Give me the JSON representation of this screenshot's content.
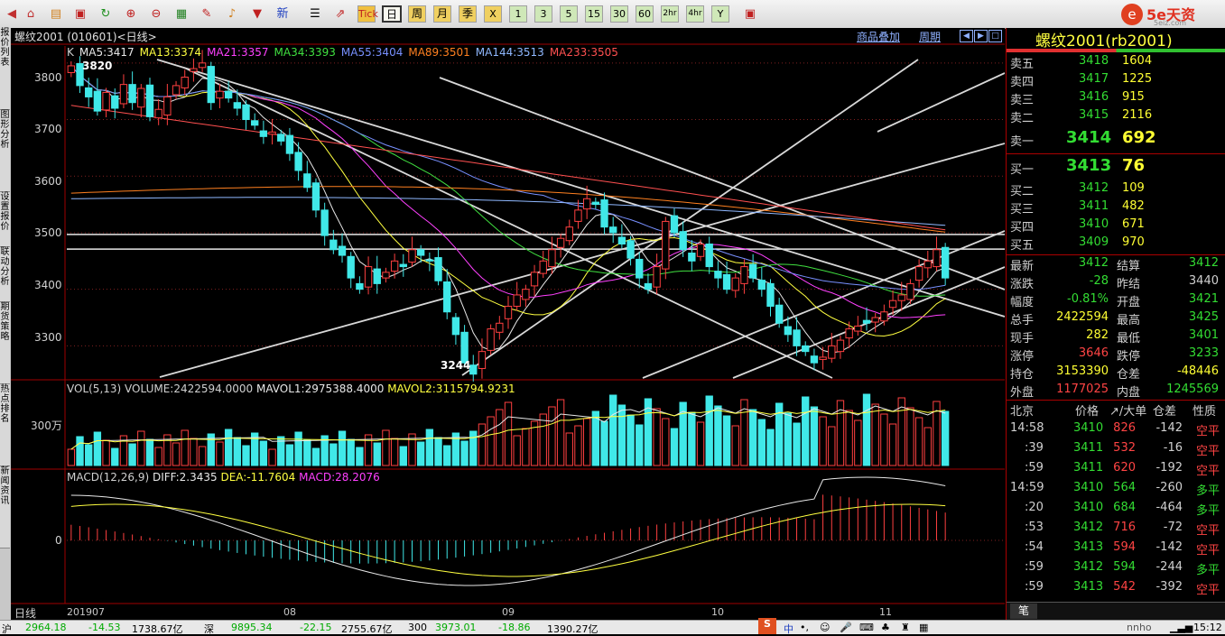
{
  "toolbar": {
    "buttons": [
      "Tick",
      "日",
      "周",
      "月",
      "季",
      "X",
      "1",
      "3",
      "5",
      "15",
      "30",
      "60",
      "2hr",
      "4hr",
      "Y"
    ],
    "xin": "新"
  },
  "leftrail": {
    "tabs": [
      "报价列表",
      "图形分析",
      "设置报价",
      "联动分析",
      "期货策略",
      "热点排名",
      "新闻资讯"
    ]
  },
  "chart": {
    "title": "螺纹2001 (010601)<日线>",
    "overlay_link": "商品叠加",
    "period_link": "周期",
    "ma_legend": [
      {
        "text": "K",
        "color": "#d0d0d0"
      },
      {
        "text": "MA5:3417",
        "color": "#e8e8e8"
      },
      {
        "text": "MA13:3374",
        "color": "#ffff40"
      },
      {
        "text": "MA21:3357",
        "color": "#ff40ff"
      },
      {
        "text": "MA34:3393",
        "color": "#40e040"
      },
      {
        "text": "MA55:3404",
        "color": "#7890ff"
      },
      {
        "text": "MA89:3501",
        "color": "#ff8020"
      },
      {
        "text": "MA144:3513",
        "color": "#8fb8ff"
      },
      {
        "text": "MA233:3505",
        "color": "#ff5050"
      }
    ],
    "price_axis": [
      "3800",
      "3700",
      "3600",
      "3500",
      "3400",
      "3300"
    ],
    "high_label": "3820",
    "low_label": "3244",
    "vol_legend": {
      "name": "VOL(5,13)",
      "volume": "VOLUME:2422594.0000",
      "mavol1": "MAVOL1:2975388.4000",
      "mavol2": "MAVOL2:3115794.9231"
    },
    "vol_axis": "300万",
    "macd_legend": {
      "name": "MACD(12,26,9)",
      "diff": "DIFF:2.3435",
      "dea": "DEA:-11.7604",
      "macd": "MACD:28.2076"
    },
    "macd_axis": "0",
    "x_axis": [
      "201907",
      "08",
      "09",
      "10",
      "11"
    ],
    "period_label": "日线"
  },
  "chart_data": {
    "type": "candlestick",
    "title": "螺纹2001 (010601)<日线>",
    "x_labels": [
      "201907",
      "08",
      "09",
      "10",
      "11"
    ],
    "y_range": [
      3240,
      3830
    ],
    "closes": [
      3795,
      3760,
      3740,
      3715,
      3748,
      3720,
      3762,
      3730,
      3755,
      3705,
      3718,
      3740,
      3760,
      3775,
      3790,
      3800,
      3730,
      3750,
      3738,
      3720,
      3700,
      3690,
      3670,
      3678,
      3662,
      3640,
      3610,
      3580,
      3540,
      3495,
      3470,
      3460,
      3420,
      3400,
      3440,
      3410,
      3430,
      3450,
      3440,
      3470,
      3460,
      3450,
      3415,
      3360,
      3320,
      3270,
      3250,
      3290,
      3330,
      3340,
      3370,
      3390,
      3400,
      3430,
      3450,
      3470,
      3490,
      3510,
      3540,
      3560,
      3550,
      3510,
      3500,
      3480,
      3455,
      3420,
      3400,
      3440,
      3520,
      3500,
      3470,
      3450,
      3480,
      3440,
      3420,
      3400,
      3420,
      3440,
      3420,
      3400,
      3370,
      3340,
      3320,
      3300,
      3290,
      3270,
      3280,
      3300,
      3310,
      3330,
      3335,
      3340,
      3350,
      3360,
      3380,
      3390,
      3410,
      3440,
      3450,
      3470,
      3420
    ],
    "ma_current": {
      "MA5": 3417,
      "MA13": 3374,
      "MA21": 3357,
      "MA34": 3393,
      "MA55": 3404,
      "MA89": 3501,
      "MA144": 3513,
      "MA233": 3505
    },
    "high": 3820,
    "low": 3244
  },
  "quote": {
    "name": "螺纹2001(rb2001)",
    "asks": [
      {
        "label": "卖五",
        "price": "3418",
        "vol": "1604"
      },
      {
        "label": "卖四",
        "price": "3417",
        "vol": "1225"
      },
      {
        "label": "卖三",
        "price": "3416",
        "vol": "915"
      },
      {
        "label": "卖二",
        "price": "3415",
        "vol": "2116"
      }
    ],
    "ask1": {
      "label": "卖一",
      "price": "3414",
      "vol": "692"
    },
    "bid1": {
      "label": "买一",
      "price": "3413",
      "vol": "76"
    },
    "bids": [
      {
        "label": "买二",
        "price": "3412",
        "vol": "109"
      },
      {
        "label": "买三",
        "price": "3411",
        "vol": "482"
      },
      {
        "label": "买四",
        "price": "3410",
        "vol": "671"
      },
      {
        "label": "买五",
        "price": "3409",
        "vol": "970"
      }
    ],
    "stats": [
      {
        "l1": "最新",
        "v1": "3412",
        "c1": "g",
        "l2": "结算",
        "v2": "3412",
        "c2": "g"
      },
      {
        "l1": "涨跌",
        "v1": "-28",
        "c1": "g",
        "l2": "昨结",
        "v2": "3440",
        "c2": "w"
      },
      {
        "l1": "幅度",
        "v1": "-0.81%",
        "c1": "g",
        "l2": "开盘",
        "v2": "3421",
        "c2": "g"
      },
      {
        "l1": "总手",
        "v1": "2422594",
        "c1": "y",
        "l2": "最高",
        "v2": "3425",
        "c2": "g"
      },
      {
        "l1": "现手",
        "v1": "282",
        "c1": "y",
        "l2": "最低",
        "v2": "3401",
        "c2": "g"
      },
      {
        "l1": "涨停",
        "v1": "3646",
        "c1": "r",
        "l2": "跌停",
        "v2": "3233",
        "c2": "g"
      },
      {
        "l1": "持仓",
        "v1": "3153390",
        "c1": "y",
        "l2": "仓差",
        "v2": "-48446",
        "c2": "y"
      },
      {
        "l1": "外盘",
        "v1": "1177025",
        "c1": "r",
        "l2": "内盘",
        "v2": "1245569",
        "c2": "g"
      }
    ],
    "ticks_header": {
      "loc": "北京",
      "price": "价格",
      "big": "↗/大单",
      "diff": "仓差",
      "nature": "性质"
    },
    "ticks": [
      {
        "t": "14:58",
        "p": "3410",
        "q": "826",
        "d": "-142",
        "n": "空平",
        "qc": "r",
        "nc": "r"
      },
      {
        "t": ":39",
        "p": "3411",
        "q": "532",
        "d": "-16",
        "n": "空平",
        "qc": "r",
        "nc": "r"
      },
      {
        "t": ":59",
        "p": "3411",
        "q": "620",
        "d": "-192",
        "n": "空平",
        "qc": "r",
        "nc": "r"
      },
      {
        "t": "14:59",
        "p": "3410",
        "q": "564",
        "d": "-260",
        "n": "多平",
        "qc": "g",
        "nc": "g"
      },
      {
        "t": ":20",
        "p": "3410",
        "q": "684",
        "d": "-464",
        "n": "多平",
        "qc": "g",
        "nc": "g"
      },
      {
        "t": ":53",
        "p": "3412",
        "q": "716",
        "d": "-72",
        "n": "空平",
        "qc": "r",
        "nc": "r"
      },
      {
        "t": ":54",
        "p": "3413",
        "q": "594",
        "d": "-142",
        "n": "空平",
        "qc": "r",
        "nc": "r"
      },
      {
        "t": ":59",
        "p": "3412",
        "q": "594",
        "d": "-244",
        "n": "多平",
        "qc": "g",
        "nc": "g"
      },
      {
        "t": ":59",
        "p": "3413",
        "q": "542",
        "d": "-392",
        "n": "空平",
        "qc": "r",
        "nc": "r"
      }
    ],
    "tab": "笔"
  },
  "brand": {
    "text": "5e天资",
    "sub": "5eiz.com"
  },
  "status": {
    "s1": "沪",
    "s1v": "2964.18",
    "s1c": "-14.53",
    "s1a": "1738.67亿",
    "s2": "深",
    "s2v": "9895.34",
    "s2c": "-22.15",
    "s2a": "2755.67亿",
    "s3": "300",
    "s3v": "3973.01",
    "s3c": "-18.86",
    "s3a": "1390.27亿",
    "ime": "中",
    "time": "15:12"
  }
}
